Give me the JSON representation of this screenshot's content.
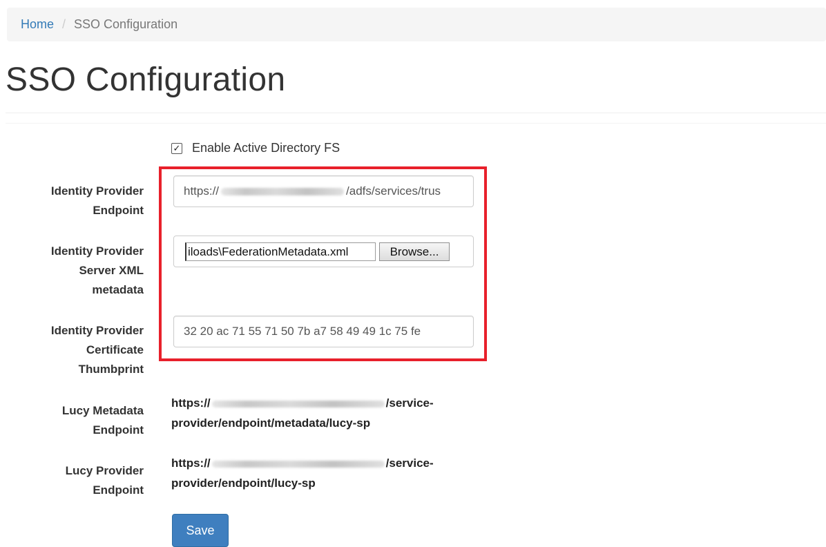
{
  "breadcrumb": {
    "home": "Home",
    "separator": "/",
    "current": "SSO Configuration"
  },
  "page": {
    "title": "SSO Configuration"
  },
  "form": {
    "enable_adfs": {
      "label": "Enable Active Directory FS",
      "checked": true,
      "check_glyph": "✓"
    },
    "idp_endpoint": {
      "label_lines": [
        "Identity Provider",
        "Endpoint"
      ],
      "value_prefix": "https://",
      "value_suffix": "/adfs/services/trus"
    },
    "idp_metadata": {
      "label_lines": [
        "Identity Provider",
        "Server XML",
        "metadata"
      ],
      "file_name": "iloads\\FederationMetadata.xml",
      "browse_label": "Browse..."
    },
    "idp_thumbprint": {
      "label_lines": [
        "Identity Provider",
        "Certificate",
        "Thumbprint"
      ],
      "value": "32 20 ac 71 55 71 50 7b a7 58 49 49 1c 75 fe"
    },
    "lucy_metadata_endpoint": {
      "label_lines": [
        "Lucy Metadata",
        "Endpoint"
      ],
      "line1_prefix": "https://",
      "line1_suffix": "/service-",
      "line2": "provider/endpoint/metadata/lucy-sp"
    },
    "lucy_provider_endpoint": {
      "label_lines": [
        "Lucy Provider",
        "Endpoint"
      ],
      "line1_prefix": "https://",
      "line1_suffix": "/service-",
      "line2": "provider/endpoint/lucy-sp"
    },
    "save_label": "Save"
  },
  "colors": {
    "link": "#337ab7",
    "highlight_border": "#e8202b",
    "primary_button": "#3f7fbf"
  }
}
